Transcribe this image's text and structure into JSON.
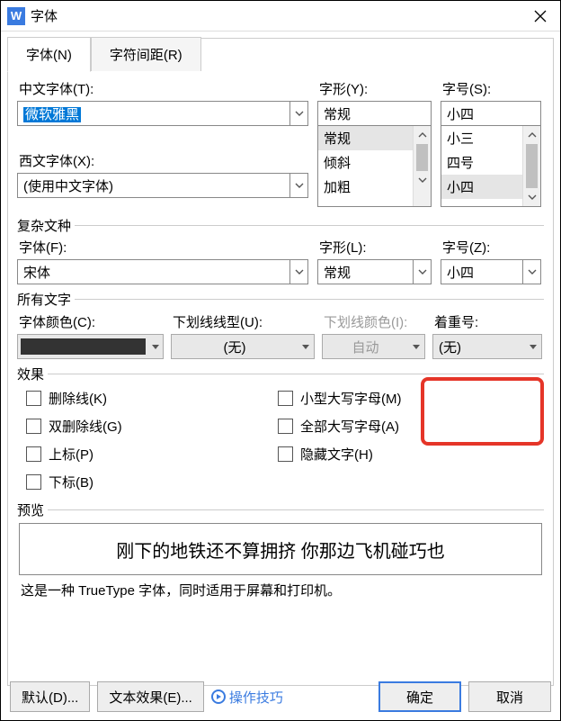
{
  "window": {
    "title": "字体"
  },
  "tabs": {
    "font": "字体(N)",
    "spacing": "字符间距(R)"
  },
  "cnFont": {
    "label": "中文字体(T):",
    "value": "微软雅黑"
  },
  "style": {
    "label": "字形(Y):",
    "value": "常规",
    "options": [
      "常规",
      "倾斜",
      "加粗"
    ]
  },
  "size": {
    "label": "字号(S):",
    "value": "小四",
    "options": [
      "小三",
      "四号",
      "小四"
    ]
  },
  "enFont": {
    "label": "西文字体(X):",
    "value": "(使用中文字体)"
  },
  "complex": {
    "legend": "复杂文种",
    "font": {
      "label": "字体(F):",
      "value": "宋体"
    },
    "style": {
      "label": "字形(L):",
      "value": "常规"
    },
    "size": {
      "label": "字号(Z):",
      "value": "小四"
    }
  },
  "all": {
    "legend": "所有文字",
    "color": {
      "label": "字体颜色(C):"
    },
    "underline": {
      "label": "下划线线型(U):",
      "value": "(无)"
    },
    "ulcolor": {
      "label": "下划线颜色(I):",
      "value": "自动"
    },
    "emphasis": {
      "label": "着重号:",
      "value": "(无)"
    }
  },
  "effects": {
    "legend": "效果",
    "strike": "删除线(K)",
    "dstrike": "双删除线(G)",
    "super": "上标(P)",
    "sub": "下标(B)",
    "smallcaps": "小型大写字母(M)",
    "allcaps": "全部大写字母(A)",
    "hidden": "隐藏文字(H)"
  },
  "preview": {
    "legend": "预览",
    "text": "刚下的地铁还不算拥挤   你那边飞机碰巧也",
    "note": "这是一种 TrueType 字体，同时适用于屏幕和打印机。"
  },
  "buttons": {
    "default": "默认(D)...",
    "textfx": "文本效果(E)...",
    "tips": "操作技巧",
    "ok": "确定",
    "cancel": "取消"
  }
}
